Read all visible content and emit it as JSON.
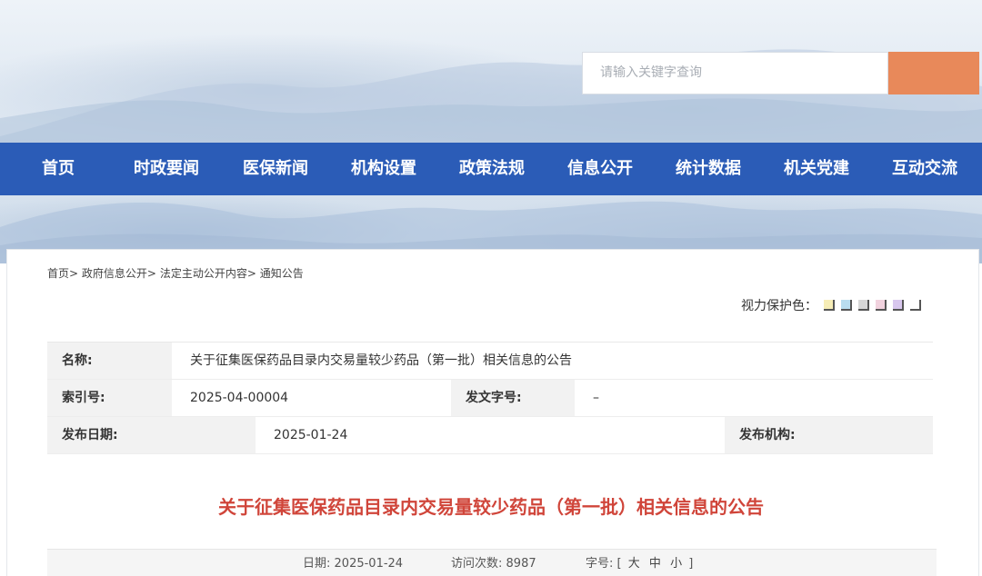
{
  "search": {
    "placeholder": "请输入关键字查询"
  },
  "nav": {
    "items": [
      "首页",
      "时政要闻",
      "医保新闻",
      "机构设置",
      "政策法规",
      "信息公开",
      "统计数据",
      "机关党建",
      "互动交流"
    ]
  },
  "breadcrumb": {
    "items": [
      "首页",
      "政府信息公开",
      "法定主动公开内容",
      "通知公告"
    ],
    "separator": ">"
  },
  "vision": {
    "label": "视力保护色：",
    "colors": [
      "#f6edb6",
      "#b9ddef",
      "#d7d7d7",
      "#f1d2de",
      "#d8c7ee",
      "#ffffff"
    ]
  },
  "meta": {
    "name_label": "名称:",
    "name_value": "关于征集医保药品目录内交易量较少药品（第一批）相关信息的公告",
    "index_label": "索引号:",
    "index_value": "2025-04-00004",
    "docno_label": "发文字号:",
    "docno_value": "–",
    "date_label": "发布日期:",
    "date_value": "2025-01-24",
    "org_label": "发布机构:",
    "org_value": ""
  },
  "article": {
    "title": "关于征集医保药品目录内交易量较少药品（第一批）相关信息的公告"
  },
  "info": {
    "date_label": "日期:",
    "date_value": "2025-01-24",
    "visits_label": "访问次数:",
    "visits_value": "8987",
    "fontsize_label": "字号:",
    "open_bracket": "[",
    "size_large": "大",
    "size_medium": "中",
    "size_small": "小",
    "close_bracket": "]"
  },
  "colors": {
    "nav_bg": "#2b5cb7",
    "search_button": "#e8895a",
    "title_red": "#d0453a"
  }
}
